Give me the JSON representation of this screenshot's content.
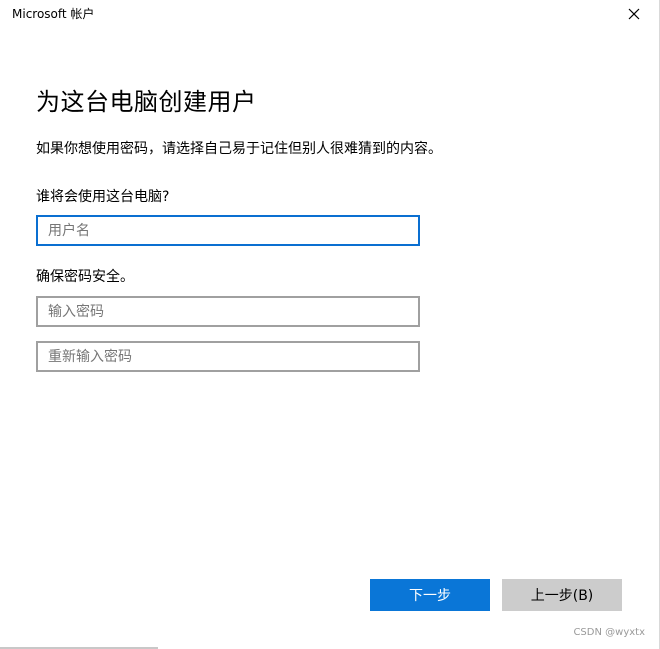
{
  "window": {
    "title": "Microsoft 帐户",
    "close_icon": "close-icon"
  },
  "main": {
    "heading": "为这台电脑创建用户",
    "description": "如果你想使用密码，请选择自己易于记住但别人很难猜到的内容。",
    "who_label": "谁将会使用这台电脑?",
    "username_placeholder": "用户名",
    "username_value": "",
    "secure_label": "确保密码安全。",
    "password_placeholder": "输入密码",
    "password_value": "",
    "password_confirm_placeholder": "重新输入密码",
    "password_confirm_value": ""
  },
  "buttons": {
    "next_label": "下一步",
    "back_label": "上一步(B)"
  },
  "watermark": "CSDN @wyxtx",
  "colors": {
    "accent": "#0a76d7",
    "focus_border": "#0a6fd1",
    "secondary_button": "#cccccc",
    "field_border": "#a0a0a0"
  }
}
